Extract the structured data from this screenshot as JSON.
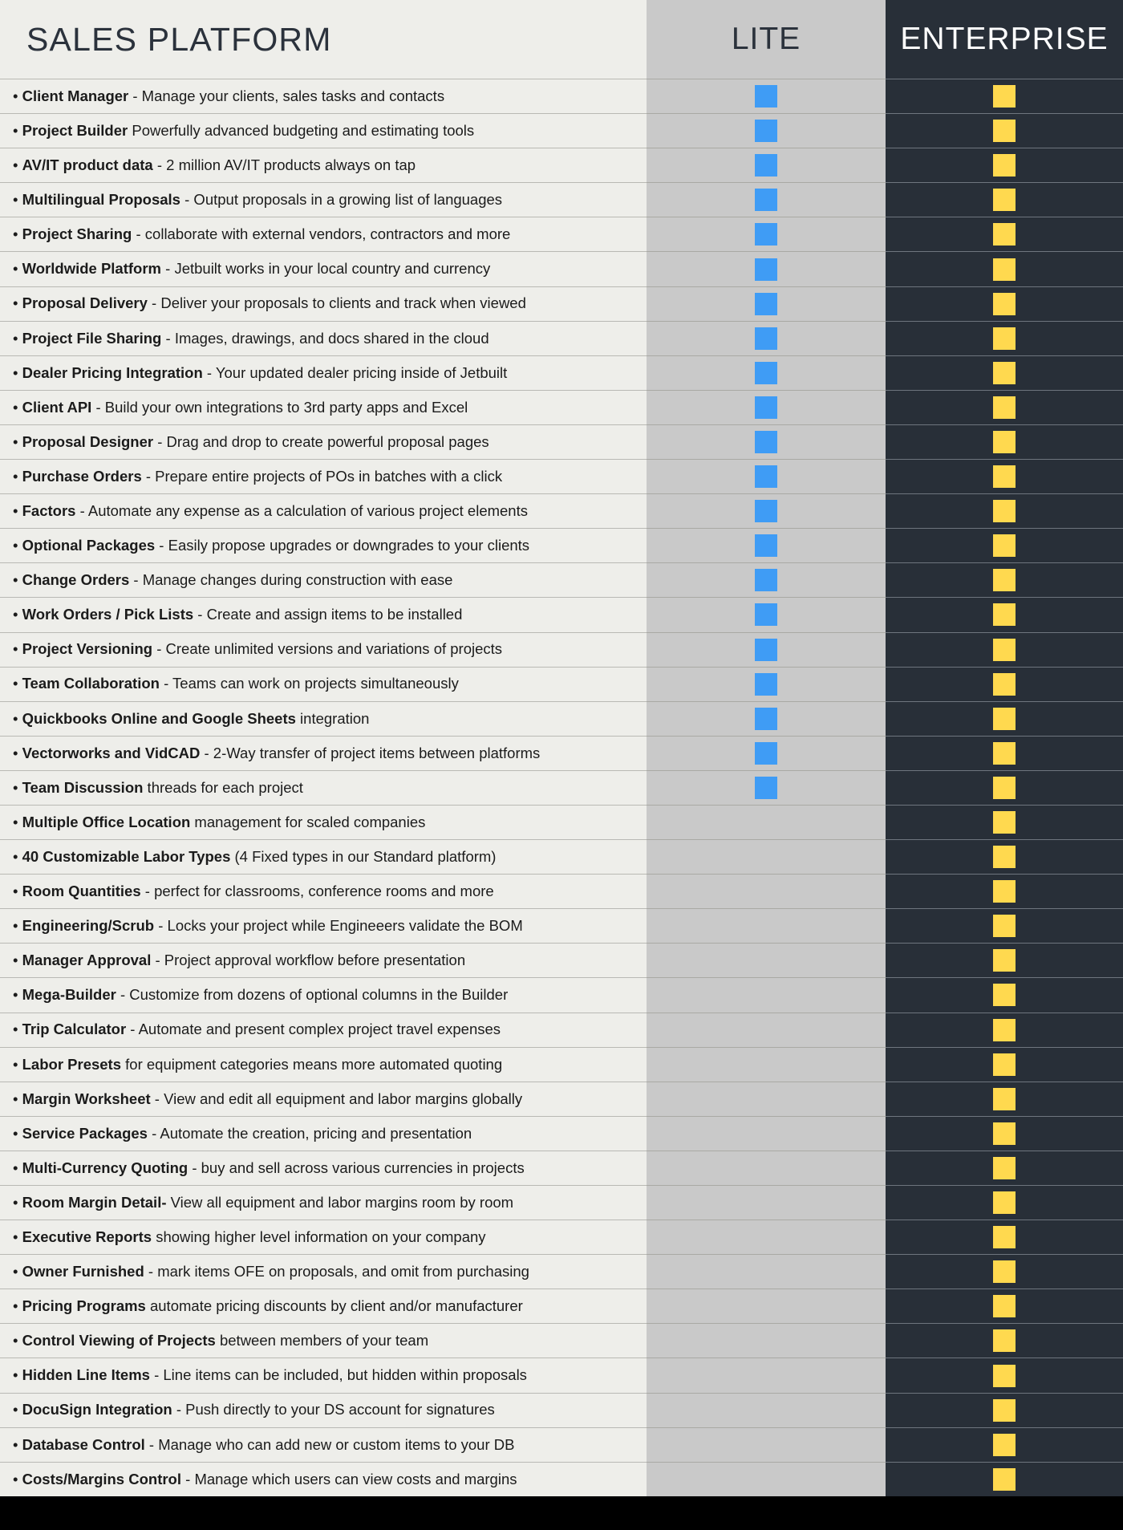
{
  "header": {
    "feature_column_title": "SALES PLATFORM",
    "lite_column_title": "LITE",
    "enterprise_column_title": "ENTERPRISE"
  },
  "colors": {
    "feature_bg": "#eeeeea",
    "lite_bg": "#c9c9c9",
    "enterprise_bg": "#282f38",
    "lite_marker": "#3f9cf5",
    "enterprise_marker": "#ffd94f",
    "page_bg": "#000000",
    "text": "#1b1b1b",
    "header_text": "#2b323c",
    "enterprise_header_text": "#ffffff"
  },
  "markers": {
    "lite": "blue-square-marker",
    "enterprise": "yellow-square-marker"
  },
  "rows": [
    {
      "bullet": "•",
      "name": "Client Manager",
      "desc": " -  Manage your clients, sales tasks and contacts",
      "lite": true,
      "enterprise": true
    },
    {
      "bullet": "•",
      "name": "Project Builder",
      "desc": " Powerfully advanced budgeting and estimating tools",
      "lite": true,
      "enterprise": true
    },
    {
      "bullet": "•",
      "name": "AV/IT product data",
      "desc": " -  2 million AV/IT products always on tap",
      "lite": true,
      "enterprise": true
    },
    {
      "bullet": "•",
      "name": "Multilingual Proposals",
      "desc": " - Output proposals in a growing list of languages",
      "lite": true,
      "enterprise": true
    },
    {
      "bullet": "•",
      "name": "Project Sharing",
      "desc": " -  collaborate with external vendors, contractors and more",
      "lite": true,
      "enterprise": true
    },
    {
      "bullet": "•",
      "name": "Worldwide Platform",
      "desc": " -  Jetbuilt works in your local country and currency",
      "lite": true,
      "enterprise": true
    },
    {
      "bullet": "•",
      "name": "Proposal Delivery",
      "desc": " - Deliver your proposals to clients and track when viewed",
      "lite": true,
      "enterprise": true
    },
    {
      "bullet": "•",
      "name": "Project File Sharing",
      "desc": " - Images, drawings, and docs shared in the cloud",
      "lite": true,
      "enterprise": true
    },
    {
      "bullet": "•",
      "name": "Dealer Pricing Integration",
      "desc": " - Your updated dealer pricing inside of Jetbuilt",
      "lite": true,
      "enterprise": true
    },
    {
      "bullet": "•",
      "name": "Client API",
      "desc": " - Build your own integrations to 3rd party apps and Excel",
      "lite": true,
      "enterprise": true
    },
    {
      "bullet": "•",
      "name": "Proposal Designer",
      "desc": " - Drag and drop to create powerful proposal pages",
      "lite": true,
      "enterprise": true
    },
    {
      "bullet": "•",
      "name": "Purchase Orders",
      "desc": " -  Prepare entire projects of POs in batches with a click",
      "lite": true,
      "enterprise": true
    },
    {
      "bullet": "•",
      "name": "Factors",
      "desc": " - Automate any expense as a calculation of various project elements",
      "lite": true,
      "enterprise": true
    },
    {
      "bullet": "•",
      "name": "Optional Packages",
      "desc": " - Easily propose upgrades or downgrades to your clients",
      "lite": true,
      "enterprise": true
    },
    {
      "bullet": "•",
      "name": "Change Orders",
      "desc": " - Manage changes during construction with ease",
      "lite": true,
      "enterprise": true
    },
    {
      "bullet": "•",
      "name": "Work Orders / Pick Lists",
      "desc": " - Create and assign items to be installed",
      "lite": true,
      "enterprise": true
    },
    {
      "bullet": "•",
      "name": "Project Versioning",
      "desc": " - Create unlimited versions and variations of projects",
      "lite": true,
      "enterprise": true
    },
    {
      "bullet": "•",
      "name": "Team Collaboration",
      "desc": " - Teams can work on projects simultaneously",
      "lite": true,
      "enterprise": true
    },
    {
      "bullet": "•",
      "name": "Quickbooks Online and Google Sheets",
      "desc": " integration",
      "lite": true,
      "enterprise": true
    },
    {
      "bullet": "•",
      "name": "Vectorworks and VidCAD",
      "desc": " - 2-Way transfer of project items between platforms",
      "lite": true,
      "enterprise": true
    },
    {
      "bullet": "•",
      "name": "Team Discussion",
      "desc": " threads for each project",
      "lite": true,
      "enterprise": true
    },
    {
      "bullet": "•",
      "name": "Multiple Office Location",
      "desc": " management for scaled companies",
      "lite": false,
      "enterprise": true
    },
    {
      "bullet": "•",
      "name": "40 Customizable Labor Types",
      "desc": " (4 Fixed types in our Standard platform)",
      "lite": false,
      "enterprise": true
    },
    {
      "bullet": "•",
      "name": "Room Quantities",
      "desc": " - perfect for classrooms, conference rooms and more",
      "lite": false,
      "enterprise": true
    },
    {
      "bullet": "•",
      "name": "Engineering/Scrub",
      "desc": " - Locks your project while Engineeers validate the BOM",
      "lite": false,
      "enterprise": true
    },
    {
      "bullet": "•",
      "name": "Manager Approval",
      "desc": " - Project approval workflow before presentation",
      "lite": false,
      "enterprise": true
    },
    {
      "bullet": "•",
      "name": "Mega-Builder",
      "desc": " - Customize from dozens of optional columns in the Builder",
      "lite": false,
      "enterprise": true
    },
    {
      "bullet": "•",
      "name": "Trip Calculator",
      "desc": "  - Automate and present complex project travel expenses",
      "lite": false,
      "enterprise": true
    },
    {
      "bullet": "•",
      "name": "Labor Presets",
      "desc": " for equipment categories means more automated quoting",
      "lite": false,
      "enterprise": true
    },
    {
      "bullet": "•",
      "name": "Margin Worksheet",
      "desc": " - View and edit all equipment and labor margins globally",
      "lite": false,
      "enterprise": true
    },
    {
      "bullet": "•",
      "name": "Service Packages",
      "desc": " - Automate the creation, pricing and presentation",
      "lite": false,
      "enterprise": true
    },
    {
      "bullet": "•",
      "name": "Multi-Currency Quoting",
      "desc": " - buy and sell across various currencies in projects",
      "lite": false,
      "enterprise": true
    },
    {
      "bullet": "•",
      "name": "Room Margin Detail-",
      "desc": " View all equipment and labor margins room by room",
      "lite": false,
      "enterprise": true
    },
    {
      "bullet": "•",
      "name": "Executive Reports",
      "desc": " showing higher level information on your company",
      "lite": false,
      "enterprise": true
    },
    {
      "bullet": "•",
      "name": "Owner Furnished",
      "desc": " - mark items OFE on proposals, and omit from purchasing",
      "lite": false,
      "enterprise": true
    },
    {
      "bullet": "•",
      "name": "Pricing Programs",
      "desc": " automate pricing discounts by client and/or manufacturer",
      "lite": false,
      "enterprise": true
    },
    {
      "bullet": "•",
      "name": "Control Viewing of Projects",
      "desc": " between members of your team",
      "lite": false,
      "enterprise": true
    },
    {
      "bullet": "•",
      "name": "Hidden Line Items",
      "desc": "  - Line items can be included, but hidden within proposals",
      "lite": false,
      "enterprise": true
    },
    {
      "bullet": "•",
      "name": "DocuSign Integration",
      "desc": " - Push directly to your DS account for signatures",
      "lite": false,
      "enterprise": true
    },
    {
      "bullet": "•",
      "name": "Database Control",
      "desc": " - Manage who can add new or custom items to your DB",
      "lite": false,
      "enterprise": true
    },
    {
      "bullet": "•",
      "name": "Costs/Margins Control",
      "desc": " - Manage which users can view costs and margins",
      "lite": false,
      "enterprise": true
    }
  ]
}
